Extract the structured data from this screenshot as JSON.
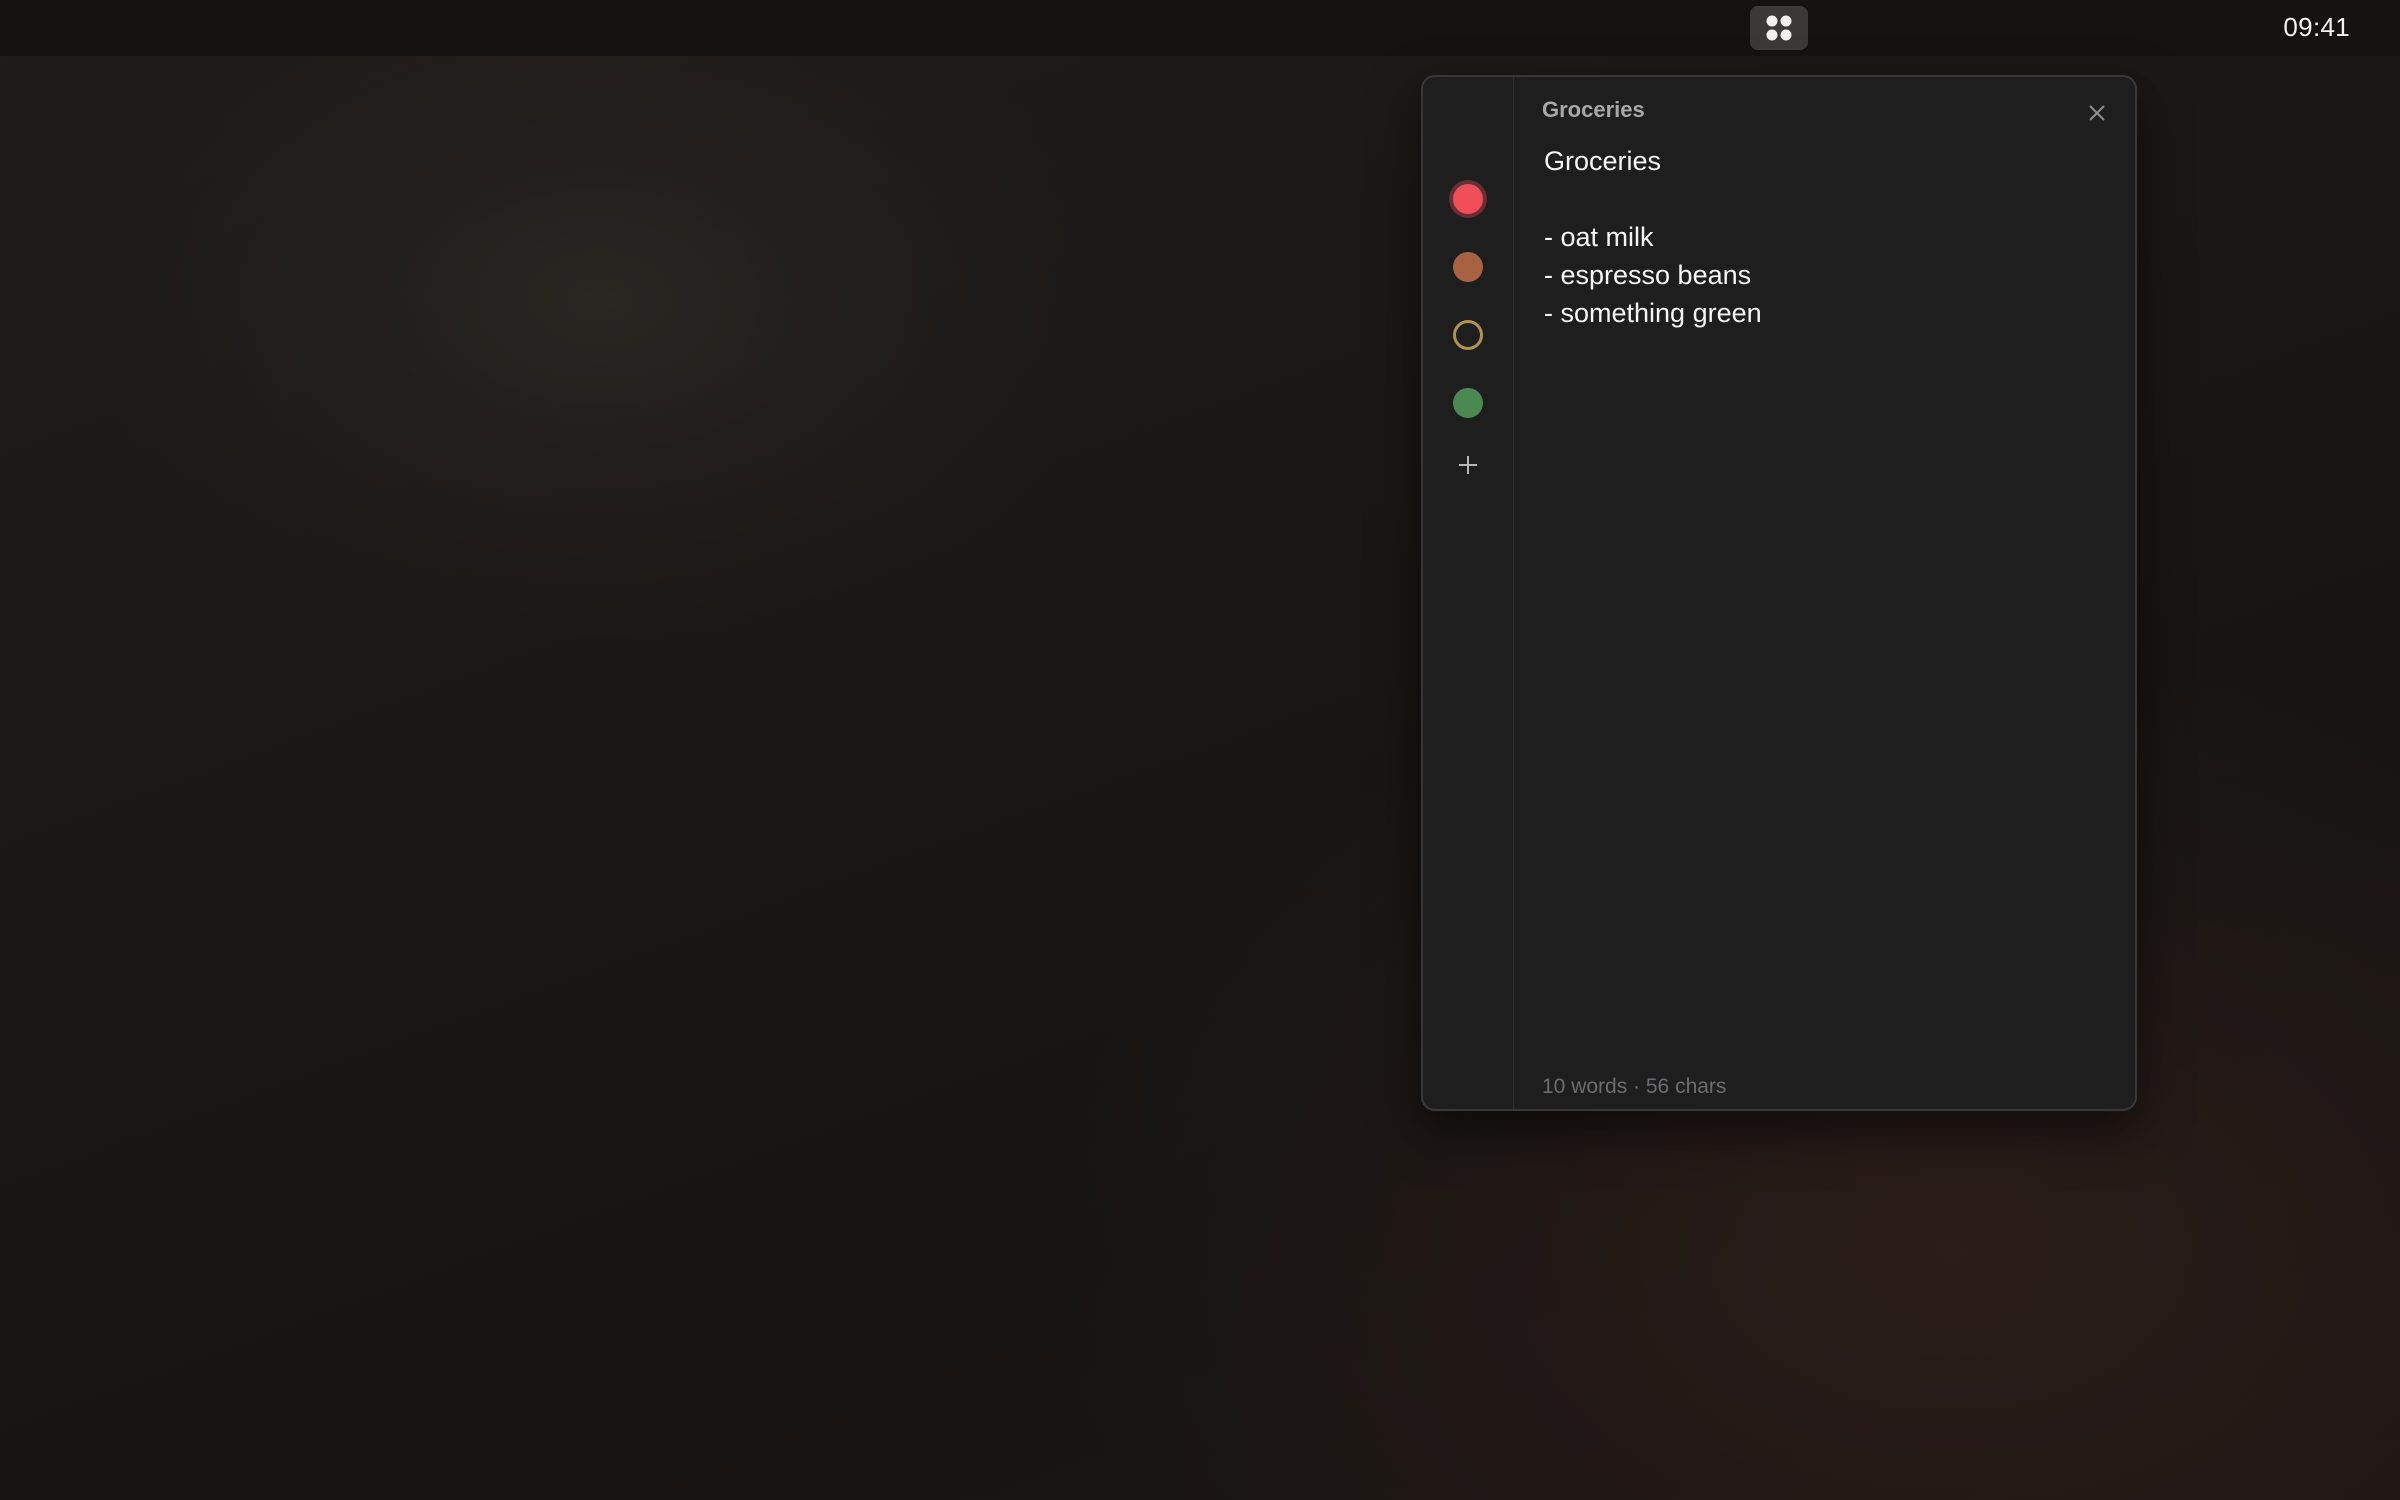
{
  "menubar": {
    "app_icon": "grid-dots-icon",
    "clock": "09:41"
  },
  "note_window": {
    "title": "Groceries",
    "colors": [
      {
        "name": "red",
        "hex": "#f04e58",
        "selected": true,
        "style": "filled"
      },
      {
        "name": "orange",
        "hex": "#a7633f",
        "selected": false,
        "style": "filled"
      },
      {
        "name": "yellow",
        "hex": "#b3934a",
        "selected": false,
        "style": "outline"
      },
      {
        "name": "green",
        "hex": "#4a8a52",
        "selected": false,
        "style": "filled"
      }
    ],
    "add_icon": "plus-icon",
    "close_icon": "close-icon",
    "content": {
      "lines": [
        "Groceries",
        "",
        "- oat milk",
        "- espresso beans",
        "- something green"
      ]
    },
    "footer": "10 words · 56 chars"
  }
}
